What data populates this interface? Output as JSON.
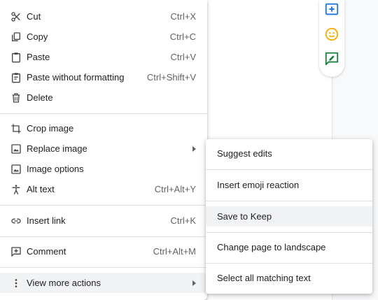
{
  "colors": {
    "menu_bg": "#ffffff",
    "highlight": "#f1f3f4",
    "shortcut_text": "#5f6368",
    "accent_blue": "#1a73e8",
    "emoji_yellow": "#f9ab00",
    "accent_green": "#188038"
  },
  "side_actions": [
    {
      "icon": "add-comment-icon"
    },
    {
      "icon": "emoji-icon"
    },
    {
      "icon": "suggest-edits-icon"
    }
  ],
  "context_menu": {
    "items": [
      {
        "label": "Cut",
        "shortcut": "Ctrl+X",
        "icon": "scissors-icon"
      },
      {
        "label": "Copy",
        "shortcut": "Ctrl+C",
        "icon": "copy-icon"
      },
      {
        "label": "Paste",
        "shortcut": "Ctrl+V",
        "icon": "clipboard-icon"
      },
      {
        "label": "Paste without formatting",
        "shortcut": "Ctrl+Shift+V",
        "icon": "clipboard-text-icon"
      },
      {
        "label": "Delete",
        "shortcut": "",
        "icon": "trash-icon"
      },
      {
        "label": "Crop image",
        "shortcut": "",
        "icon": "crop-icon"
      },
      {
        "label": "Replace image",
        "shortcut": "",
        "icon": "image-icon",
        "has_submenu": true
      },
      {
        "label": "Image options",
        "shortcut": "",
        "icon": "image-icon"
      },
      {
        "label": "Alt text",
        "shortcut": "Ctrl+Alt+Y",
        "icon": "accessibility-icon"
      },
      {
        "label": "Insert link",
        "shortcut": "Ctrl+K",
        "icon": "link-icon"
      },
      {
        "label": "Comment",
        "shortcut": "Ctrl+Alt+M",
        "icon": "add-comment-icon"
      },
      {
        "label": "View more actions",
        "shortcut": "",
        "icon": "more-vert-icon",
        "has_submenu": true,
        "highlighted": true
      }
    ]
  },
  "submenu": {
    "items": [
      {
        "label": "Suggest edits"
      },
      {
        "label": "Insert emoji reaction"
      },
      {
        "label": "Save to Keep",
        "highlighted": true
      },
      {
        "label": "Change page to landscape"
      },
      {
        "label": "Select all matching text"
      }
    ]
  }
}
